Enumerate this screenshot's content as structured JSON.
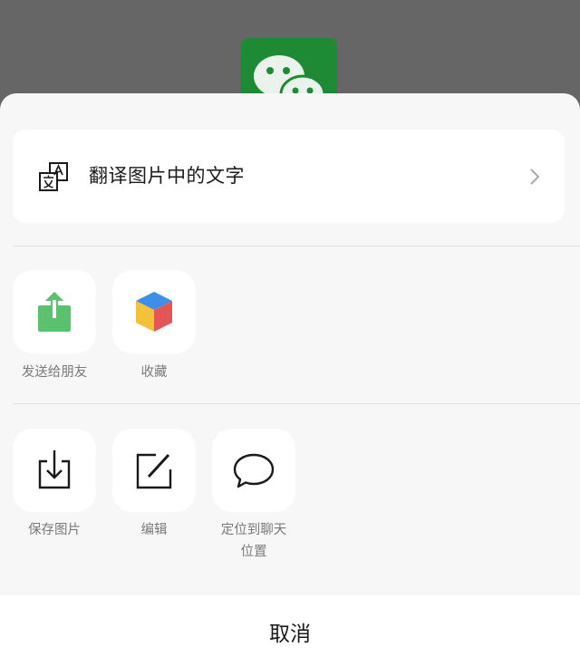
{
  "background_app": {
    "logo_icon": "wechat-logo-icon",
    "logo_color": "#1f8a34"
  },
  "sheet": {
    "translate": {
      "label": "翻译图片中的文字",
      "icon": "translate-icon",
      "chevron": "chevron-right-icon"
    },
    "share_row": [
      {
        "label": "发送给朋友",
        "icon": "share-to-friend-icon",
        "accent": "#5cc16f"
      },
      {
        "label": "收藏",
        "icon": "favorites-cube-icon",
        "accent": "#3f8ee6"
      }
    ],
    "action_row": [
      {
        "label": "保存图片",
        "icon": "save-image-icon"
      },
      {
        "label": "编辑",
        "icon": "edit-icon"
      },
      {
        "label": "定位到聊天\n位置",
        "label_lines": [
          "定位到聊天",
          "位置"
        ],
        "icon": "chat-bubble-icon"
      }
    ],
    "cancel_label": "取消"
  }
}
